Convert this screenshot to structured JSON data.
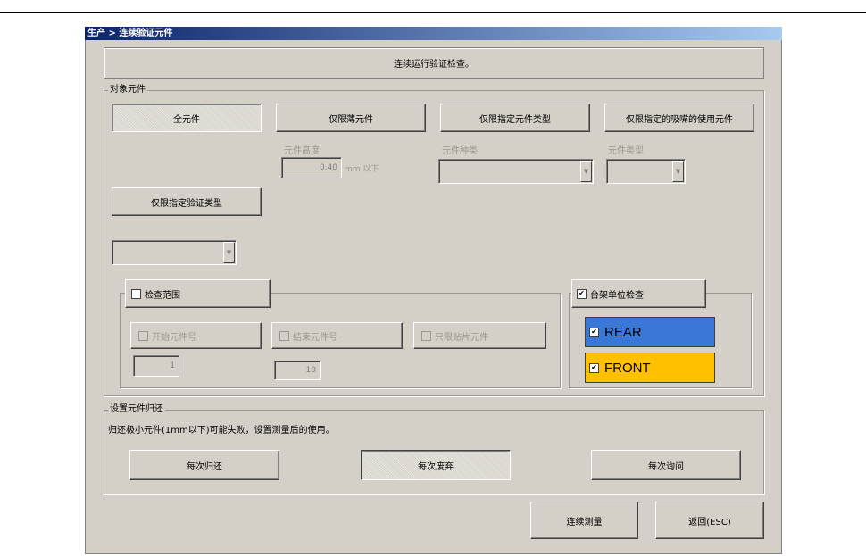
{
  "window": {
    "title": "生产 > 连续验证元件"
  },
  "info": {
    "message": "连续运行验证检查。"
  },
  "target": {
    "legend": "对象元件",
    "buttons": {
      "all": "全元件",
      "thin": "仅限薄元件",
      "comp_type": "仅限指定元件类型",
      "nozzle": "仅限指定的吸嘴的使用元件",
      "verify_type": "仅限指定验证类型"
    },
    "height_label": "元件高度",
    "height_value": "0.40",
    "height_unit": "mm 以下",
    "kind_label": "元件种类",
    "type_label": "元件类型"
  },
  "check_range": {
    "label": "检查范围",
    "start_label": "开始元件号",
    "start_value": "1",
    "end_label": "结束元件号",
    "end_value": "10",
    "only_label": "只限贴片元件"
  },
  "rack": {
    "label": "台架单位检查",
    "checked": "✔",
    "rear": "REAR",
    "front": "FRONT",
    "rear_color": "#3a78d8",
    "front_color": "#ffc000"
  },
  "restore": {
    "legend": "设置元件归还",
    "note": "归还极小元件(1mm以下)可能失败，设置测量后的使用。",
    "each_return": "每次归还",
    "each_discard": "每次废弃",
    "each_ask": "每次询问"
  },
  "footer": {
    "measure": "连续测量",
    "back": "返回(ESC)"
  }
}
